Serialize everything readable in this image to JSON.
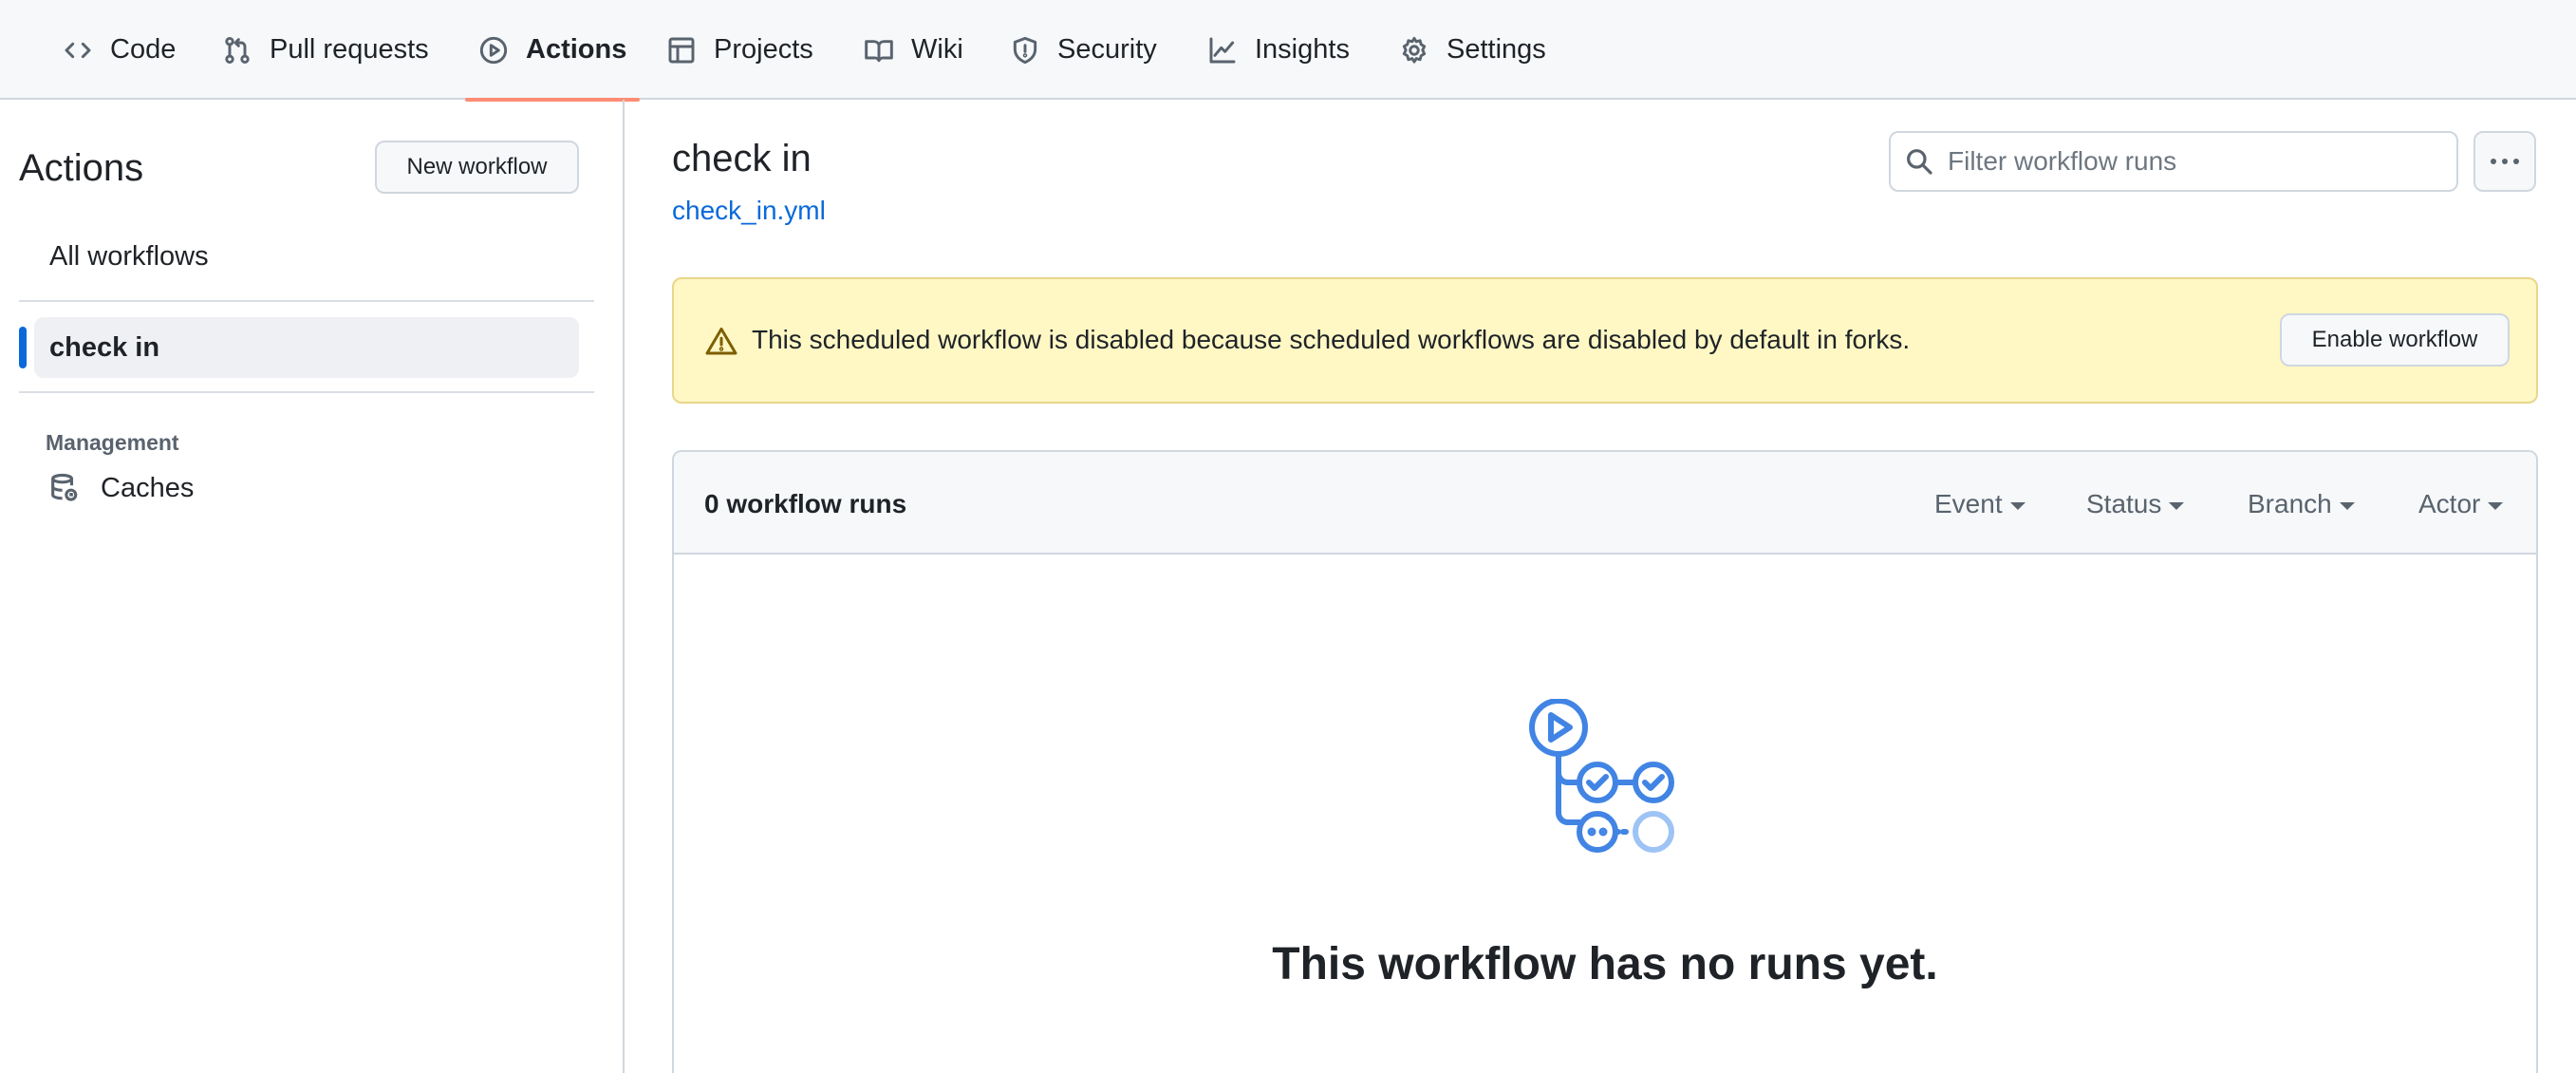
{
  "nav": {
    "tabs": [
      {
        "label": "Code",
        "icon": "code-icon"
      },
      {
        "label": "Pull requests",
        "icon": "git-pull-request-icon"
      },
      {
        "label": "Actions",
        "icon": "play-icon",
        "active": true
      },
      {
        "label": "Projects",
        "icon": "table-icon"
      },
      {
        "label": "Wiki",
        "icon": "book-icon"
      },
      {
        "label": "Security",
        "icon": "shield-icon"
      },
      {
        "label": "Insights",
        "icon": "graph-icon"
      },
      {
        "label": "Settings",
        "icon": "gear-icon"
      }
    ]
  },
  "sidebar": {
    "title": "Actions",
    "new_workflow_label": "New workflow",
    "all_workflows_label": "All workflows",
    "selected_workflow_label": "check in",
    "management_heading": "Management",
    "caches_label": "Caches"
  },
  "main": {
    "workflow_title": "check in",
    "workflow_file": "check_in.yml",
    "search_placeholder": "Filter workflow runs",
    "flash": {
      "message": "This scheduled workflow is disabled because scheduled workflows are disabled by default in forks.",
      "button_label": "Enable workflow"
    },
    "runs": {
      "count_label": "0 workflow runs",
      "filters": [
        "Event",
        "Status",
        "Branch",
        "Actor"
      ],
      "empty_title": "This workflow has no runs yet."
    }
  },
  "colors": {
    "accent": "#0969da",
    "active_tab_underline": "#fd8c73",
    "flash_bg": "#fff8c5",
    "empty_icon_blue": "#4184e4"
  }
}
